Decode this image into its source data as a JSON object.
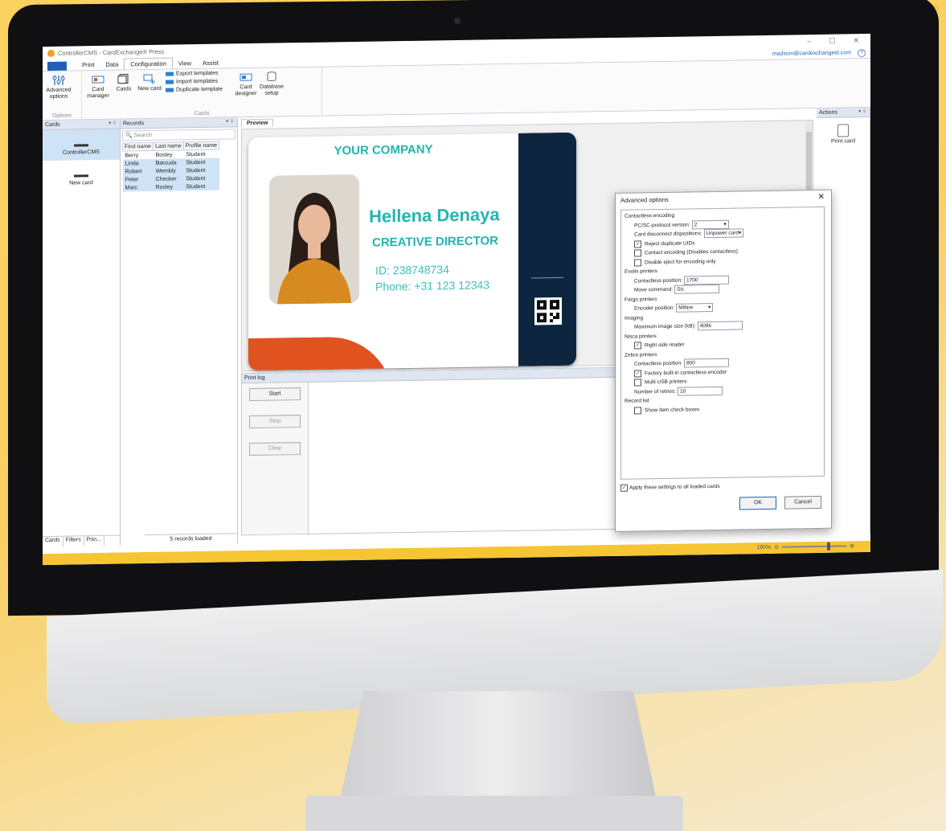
{
  "window": {
    "title": "ControllerCMS - CardExchange® Press",
    "min": "–",
    "max": "☐",
    "close": "✕"
  },
  "menu": {
    "items": [
      "Print",
      "Data",
      "Configuration",
      "View",
      "Assist"
    ],
    "active": "Configuration",
    "user": "madison@cardexchangeid.com",
    "help": "?"
  },
  "ribbon": {
    "advanced_options": "Advanced options",
    "options_group": "Options",
    "card_manager": "Card manager",
    "cards": "Cards",
    "new_card": "New card",
    "export_templates": "Export templates",
    "import_templates": "Import templates",
    "duplicate_template": "Duplicate template",
    "card_designer": "Card designer",
    "database_setup": "Database setup",
    "cards_group": "Cards"
  },
  "cards_pane": {
    "title": "Cards",
    "items": [
      "ControllerCMS",
      "New card"
    ],
    "tabs": [
      "Cards",
      "Filters",
      "Prin..."
    ]
  },
  "records_pane": {
    "title": "Records",
    "search_placeholder": "Search",
    "columns": [
      "First name",
      "Last name",
      "Profile name"
    ],
    "rows": [
      [
        "Berry",
        "Bosley",
        "Student"
      ],
      [
        "Linda",
        "Barcuda",
        "Student"
      ],
      [
        "Robert",
        "Wembly",
        "Student"
      ],
      [
        "Peter",
        "Checker",
        "Student"
      ],
      [
        "Marc",
        "Rosley",
        "Student"
      ]
    ],
    "status": "5 records loaded"
  },
  "preview": {
    "tab": "Preview"
  },
  "card": {
    "company": "YOUR COMPANY",
    "name": "Hellena Denaya",
    "role": "CREATIVE DIRECTOR",
    "id": "ID:  238748734",
    "phone": "Phone:  +31 123 12343",
    "colors": {
      "teal": "#23b5b0",
      "navy": "#0e2540",
      "orange": "#e0521f"
    }
  },
  "print_log": {
    "title": "Print log",
    "start": "Start",
    "stop": "Stop",
    "clear": "Clear"
  },
  "actions_pane": {
    "title": "Actions",
    "print_card": "Print card"
  },
  "statusbar": {
    "zoom": "190%"
  },
  "dialog": {
    "title": "Advanced options",
    "close": "✕",
    "contactless_encoding": "Contactless encoding",
    "pcsc_label": "PC/SC-protocol version:",
    "pcsc_value": "2",
    "disconnect_label": "Card disconnect dispositions:",
    "disconnect_value": "Unpower card",
    "reject_duplicate": "Reject duplicate UIDs",
    "contact_encoding": "Contact encoding (Disables contactless)",
    "disable_eject": "Disable eject for encoding only",
    "evolis_printers": "Evolis printers",
    "evolis_pos_label": "Contactless position:",
    "evolis_pos_value": "1700",
    "move_cmd_label": "Move command:",
    "move_cmd_value": "Sic",
    "fargo_printers": "Fargo printers",
    "encoder_pos_label": "Encoder position:",
    "encoder_pos_value": "Mifare",
    "imaging": "Imaging",
    "max_image_label": "Maximum image size (kB):",
    "max_image_value": "4096",
    "nisca_printers": "Nisca printers",
    "right_side_reader": "Right side reader",
    "zebra_printers": "Zebra printers",
    "zebra_pos_label": "Contactless position:",
    "zebra_pos_value": "800",
    "factory_builtin": "Factory built-in contactless encoder",
    "multi_usb": "Multi USB printers",
    "retries_label": "Number of retries:",
    "retries_value": "10",
    "record_list": "Record list",
    "show_check_boxes": "Show item check boxes",
    "apply_all": "Apply these settings to all loaded cards",
    "ok": "OK",
    "cancel": "Cancel",
    "check": "✓"
  }
}
